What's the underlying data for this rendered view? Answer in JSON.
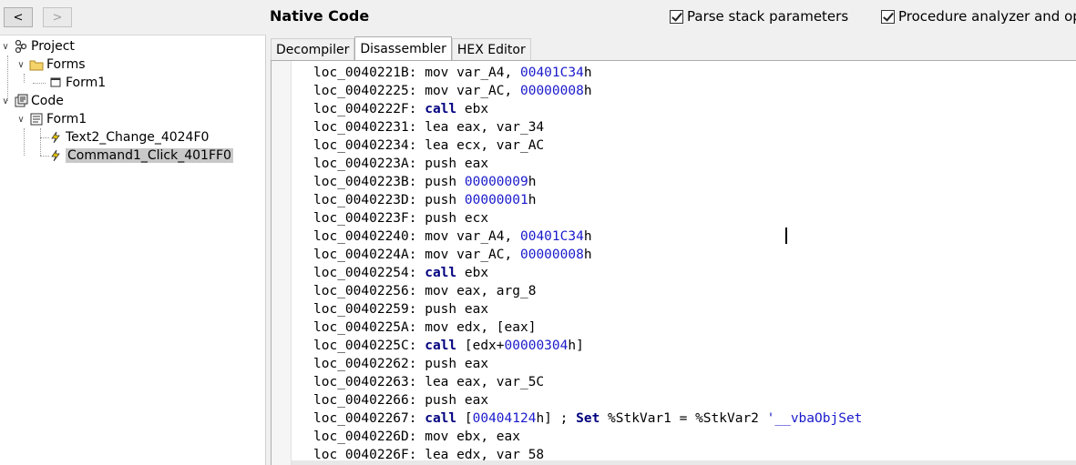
{
  "toolbar": {
    "back_label": "<",
    "forward_label": ">",
    "title": "Native Code",
    "option1": "Parse stack parameters",
    "option2": "Procedure analyzer and op"
  },
  "tree": {
    "project": "Project",
    "forms": "Forms",
    "form1_form": "Form1",
    "code": "Code",
    "form1_code": "Form1",
    "proc1": "Text2_Change_4024F0",
    "proc2": "Command1_Click_401FF0"
  },
  "tabs": [
    "Decompiler",
    "Disassembler",
    "HEX Editor"
  ],
  "code_lines": [
    [
      [
        "t",
        "loc_0040221B: mov var_A4, "
      ],
      [
        "n",
        "00401C34"
      ],
      [
        "t",
        "h"
      ]
    ],
    [
      [
        "t",
        "loc_00402225: mov var_AC, "
      ],
      [
        "n",
        "00000008"
      ],
      [
        "t",
        "h"
      ]
    ],
    [
      [
        "t",
        "loc_0040222F: "
      ],
      [
        "k",
        "call"
      ],
      [
        "t",
        " ebx"
      ]
    ],
    [
      [
        "t",
        "loc_00402231: lea eax, var_34"
      ]
    ],
    [
      [
        "t",
        "loc_00402234: lea ecx, var_AC"
      ]
    ],
    [
      [
        "t",
        "loc_0040223A: push eax"
      ]
    ],
    [
      [
        "t",
        "loc_0040223B: push "
      ],
      [
        "n",
        "00000009"
      ],
      [
        "t",
        "h"
      ]
    ],
    [
      [
        "t",
        "loc_0040223D: push "
      ],
      [
        "n",
        "00000001"
      ],
      [
        "t",
        "h"
      ]
    ],
    [
      [
        "t",
        "loc_0040223F: push ecx"
      ]
    ],
    [
      [
        "t",
        "loc_00402240: mov var_A4, "
      ],
      [
        "n",
        "00401C34"
      ],
      [
        "t",
        "h"
      ]
    ],
    [
      [
        "t",
        "loc_0040224A: mov var_AC, "
      ],
      [
        "n",
        "00000008"
      ],
      [
        "t",
        "h"
      ]
    ],
    [
      [
        "t",
        "loc_00402254: "
      ],
      [
        "k",
        "call"
      ],
      [
        "t",
        " ebx"
      ]
    ],
    [
      [
        "t",
        "loc_00402256: mov eax, arg_8"
      ]
    ],
    [
      [
        "t",
        "loc_00402259: push eax"
      ]
    ],
    [
      [
        "t",
        "loc_0040225A: mov edx, [eax]"
      ]
    ],
    [
      [
        "t",
        "loc_0040225C: "
      ],
      [
        "k",
        "call"
      ],
      [
        "t",
        " [edx+"
      ],
      [
        "n",
        "00000304"
      ],
      [
        "t",
        "h]"
      ]
    ],
    [
      [
        "t",
        "loc_00402262: push eax"
      ]
    ],
    [
      [
        "t",
        "loc_00402263: lea eax, var_5C"
      ]
    ],
    [
      [
        "t",
        "loc_00402266: push eax"
      ]
    ],
    [
      [
        "t",
        "loc_00402267: "
      ],
      [
        "k",
        "call"
      ],
      [
        "t",
        " ["
      ],
      [
        "n",
        "00404124"
      ],
      [
        "t",
        "h] ; "
      ],
      [
        "k",
        "Set"
      ],
      [
        "t",
        " %StkVar1 = %StkVar2 "
      ],
      [
        "n",
        "'__vbaObjSet"
      ]
    ],
    [
      [
        "t",
        "loc_0040226D: mov ebx, eax"
      ]
    ],
    [
      [
        "t",
        "loc_0040226F: lea edx, var_58"
      ]
    ]
  ]
}
